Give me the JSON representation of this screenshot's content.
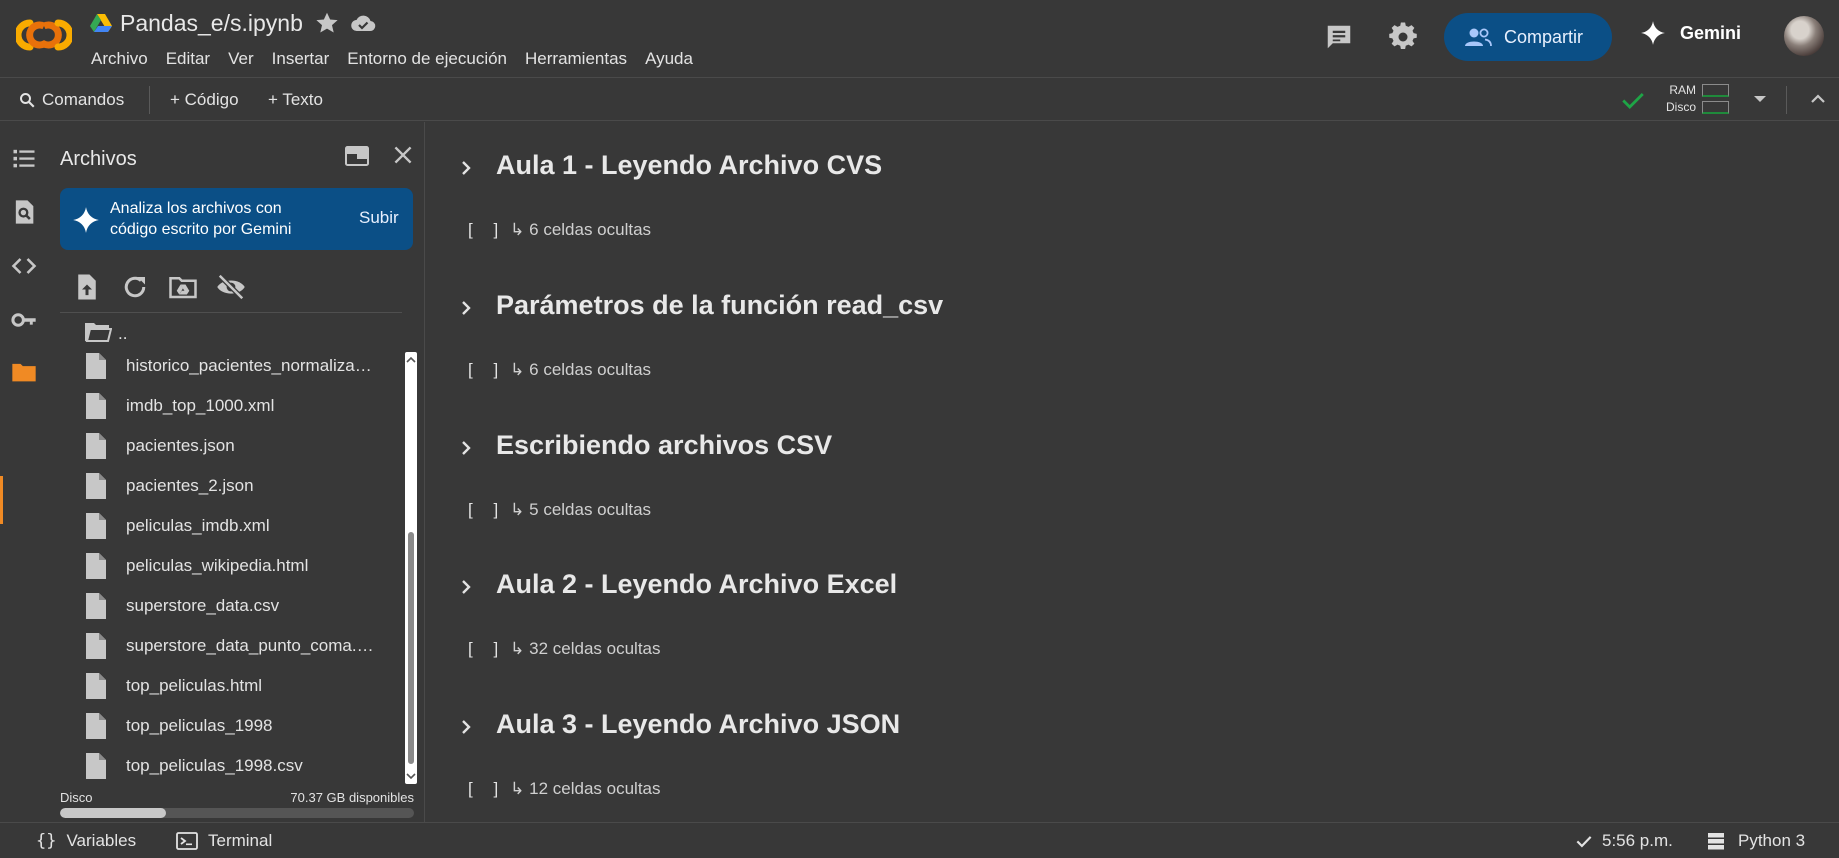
{
  "header": {
    "title": "Pandas_e/s.ipynb",
    "menu": [
      "Archivo",
      "Editar",
      "Ver",
      "Insertar",
      "Entorno de ejecución",
      "Herramientas",
      "Ayuda"
    ],
    "share_label": "Compartir",
    "gemini_label": "Gemini"
  },
  "toolbar": {
    "commands_label": "Comandos",
    "code_label": "+ Código",
    "text_label": "+ Texto",
    "ram_label": "RAM",
    "disk_label": "Disco"
  },
  "files_panel": {
    "title": "Archivos",
    "gemini_card_text": "Analiza los archivos con código escrito por Gemini",
    "gemini_card_button": "Subir",
    "parent_dir": "..",
    "files": [
      "historico_pacientes_normalizado.csv",
      "imdb_top_1000.xml",
      "pacientes.json",
      "pacientes_2.json",
      "peliculas_imdb.xml",
      "peliculas_wikipedia.html",
      "superstore_data.csv",
      "superstore_data_punto_coma.csv",
      "top_peliculas.html",
      "top_peliculas_1998",
      "top_peliculas_1998.csv"
    ],
    "disk_label": "Disco",
    "disk_free": "70.37 GB disponibles",
    "disk_used_fraction": 0.3
  },
  "sections": [
    {
      "title": "Aula 1 - Leyendo Archivo CVS",
      "bracket": "[ ]",
      "hidden": "↳ 6 celdas ocultas"
    },
    {
      "title": "Parámetros de la función read_csv",
      "bracket": "[ ]",
      "hidden": "↳ 6 celdas ocultas"
    },
    {
      "title": "Escribiendo archivos CSV",
      "bracket": "[ ]",
      "hidden": "↳ 5 celdas ocultas"
    },
    {
      "title": "Aula 2 - Leyendo Archivo Excel",
      "bracket": "[ ]",
      "hidden": "↳ 32 celdas ocultas"
    },
    {
      "title": "Aula 3 - Leyendo Archivo JSON",
      "bracket": "[ ]",
      "hidden": "↳ 12 celdas ocultas"
    }
  ],
  "statusbar": {
    "variables_label": "Variables",
    "terminal_label": "Terminal",
    "time": "5:56 p.m.",
    "runtime": "Python 3"
  },
  "colors": {
    "accent_orange": "#f08a24",
    "share_blue": "#0b4f86",
    "ok_green": "#1ea446"
  }
}
